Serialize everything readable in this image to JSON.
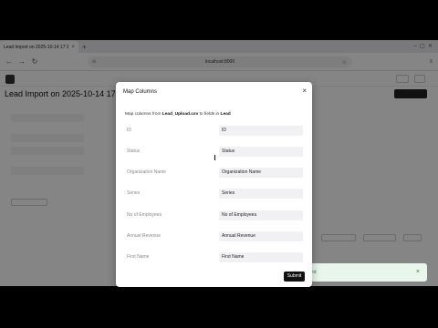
{
  "browser": {
    "tab_title": "Lead Import on 2025-10-14 17:1…",
    "tab_close": "×",
    "new_tab": "+",
    "url": "localhost:8000"
  },
  "app": {
    "page_title": "Lead Import on 2025-10-14 17…",
    "fields": [],
    "section_label": "",
    "rows": []
  },
  "toast": {
    "text": "ed",
    "close": "×"
  },
  "modal": {
    "title": "Map Columns",
    "close": "×",
    "desc_prefix": "Map columns from ",
    "file_name": "Lead_Upload.csv",
    "desc_middle": " to fields in ",
    "doctype": "Lead",
    "mappings": [
      {
        "column": "ID",
        "field": "ID"
      },
      {
        "column": "Status",
        "field": "Status"
      },
      {
        "column": "Organization Name",
        "field": "Organization Name"
      },
      {
        "column": "Series",
        "field": "Series"
      },
      {
        "column": "No of Employees",
        "field": "No of Employees"
      },
      {
        "column": "Annual Revenue",
        "field": "Annual Revenue"
      },
      {
        "column": "First Name",
        "field": "First Name"
      }
    ],
    "submit": "Submit"
  }
}
